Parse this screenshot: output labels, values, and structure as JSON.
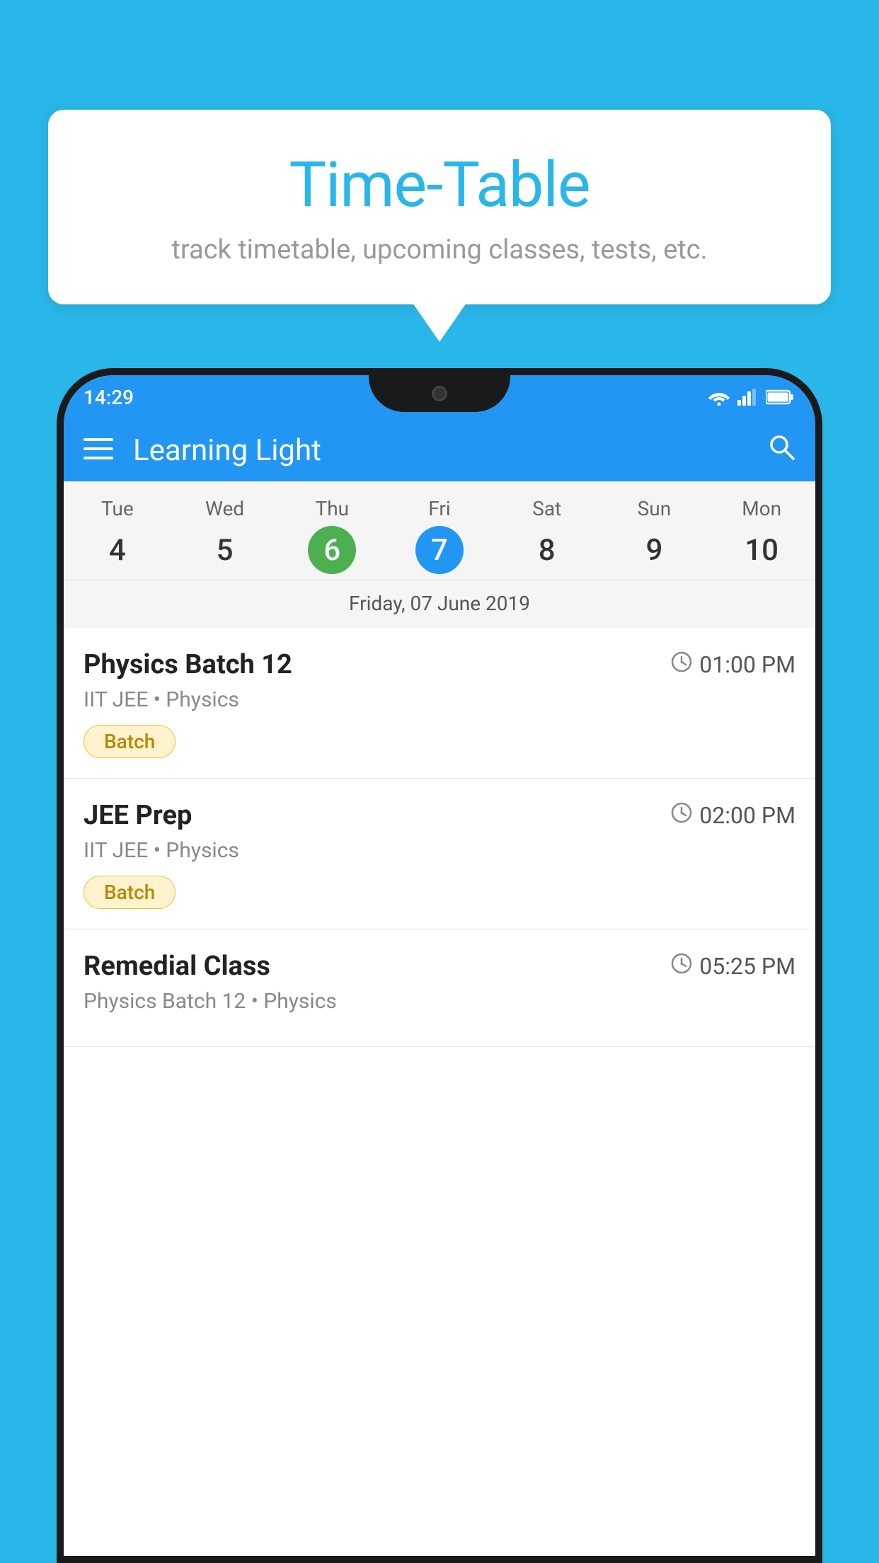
{
  "background_color": "#29B6E8",
  "speech_bubble": {
    "title": "Time-Table",
    "subtitle": "track timetable, upcoming classes, tests, etc."
  },
  "phone": {
    "status_bar": {
      "time": "14:29"
    },
    "app_bar": {
      "title": "Learning Light"
    },
    "calendar": {
      "days": [
        {
          "name": "Tue",
          "number": "4",
          "state": "normal"
        },
        {
          "name": "Wed",
          "number": "5",
          "state": "normal"
        },
        {
          "name": "Thu",
          "number": "6",
          "state": "today"
        },
        {
          "name": "Fri",
          "number": "7",
          "state": "selected"
        },
        {
          "name": "Sat",
          "number": "8",
          "state": "normal"
        },
        {
          "name": "Sun",
          "number": "9",
          "state": "normal"
        },
        {
          "name": "Mon",
          "number": "10",
          "state": "normal"
        }
      ],
      "selected_date_label": "Friday, 07 June 2019"
    },
    "classes": [
      {
        "name": "Physics Batch 12",
        "time": "01:00 PM",
        "subject": "IIT JEE • Physics",
        "badge": "Batch"
      },
      {
        "name": "JEE Prep",
        "time": "02:00 PM",
        "subject": "IIT JEE • Physics",
        "badge": "Batch"
      },
      {
        "name": "Remedial Class",
        "time": "05:25 PM",
        "subject": "Physics Batch 12 • Physics",
        "badge": null
      }
    ]
  }
}
